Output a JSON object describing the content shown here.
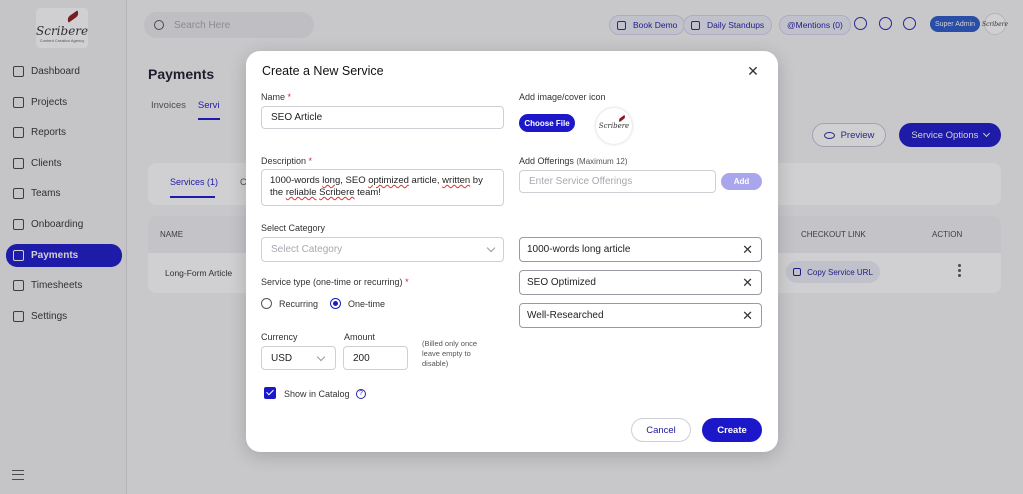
{
  "sidebar": {
    "logo_text": "Scribere",
    "logo_tag": "Content Creation Agency",
    "items": [
      {
        "label": "Dashboard",
        "icon": "grid-icon"
      },
      {
        "label": "Projects",
        "icon": "folder-icon"
      },
      {
        "label": "Reports",
        "icon": "chart-icon"
      },
      {
        "label": "Clients",
        "icon": "users-icon"
      },
      {
        "label": "Teams",
        "icon": "team-icon"
      },
      {
        "label": "Onboarding",
        "icon": "puzzle-icon"
      },
      {
        "label": "Payments",
        "icon": "wallet-icon",
        "active": true
      },
      {
        "label": "Timesheets",
        "icon": "clock-icon"
      },
      {
        "label": "Settings",
        "icon": "gear-icon"
      }
    ]
  },
  "topbar": {
    "search_placeholder": "Search Here",
    "book_demo": "Book Demo",
    "daily_standups": "Daily Standups",
    "mentions": "@Mentions (0)",
    "role": "Super Admin",
    "avatar_text": "Scribere"
  },
  "page": {
    "title": "Payments",
    "tabs": [
      "Invoices",
      "Servi"
    ],
    "preview": "Preview",
    "service_options": "Service Options",
    "sub_tab": "Services (1)",
    "sub_tab_2": "C",
    "table": {
      "headers": [
        "NAME",
        "CHECKOUT LINK",
        "ACTION"
      ],
      "row_name": "Long-Form Article",
      "copy_url": "Copy Service URL"
    }
  },
  "modal": {
    "title": "Create a New Service",
    "name_label": "Name",
    "name_value": "SEO Article",
    "description_label": "Description",
    "description_value": {
      "part1": "1000-words ",
      "w1": "long",
      "part2": ", SEO ",
      "w2": "optimized",
      "part3": " article, ",
      "w3": "written",
      "part4": " by the ",
      "w4": "reliable",
      "part5": " ",
      "w5": "Scribere",
      "part6": " team!"
    },
    "category_label": "Select Category",
    "category_placeholder": "Select Category",
    "service_type_label": "Service type (one-time or recurring)",
    "recurring": "Recurring",
    "one_time": "One-time",
    "currency_label": "Currency",
    "currency_value": "USD",
    "amount_label": "Amount",
    "amount_value": "200",
    "billed_note": "(Billed only once leave empty to disable)",
    "show_in_catalog": "Show in Catalog",
    "cover_label": "Add image/cover icon",
    "choose_file": "Choose File",
    "cover_text": "Scribere",
    "offerings_label": "Add Offerings",
    "offerings_max": "(Maximum 12)",
    "offerings_placeholder": "Enter Service Offerings",
    "add": "Add",
    "offerings": [
      "1000-words long article",
      "SEO Optimized",
      "Well-Researched"
    ],
    "cancel": "Cancel",
    "create": "Create",
    "close_glyph": "✕",
    "remove_glyph": "✕",
    "help_glyph": "?"
  },
  "colors": {
    "primary": "#1c18c9",
    "required": "#d7263d"
  }
}
